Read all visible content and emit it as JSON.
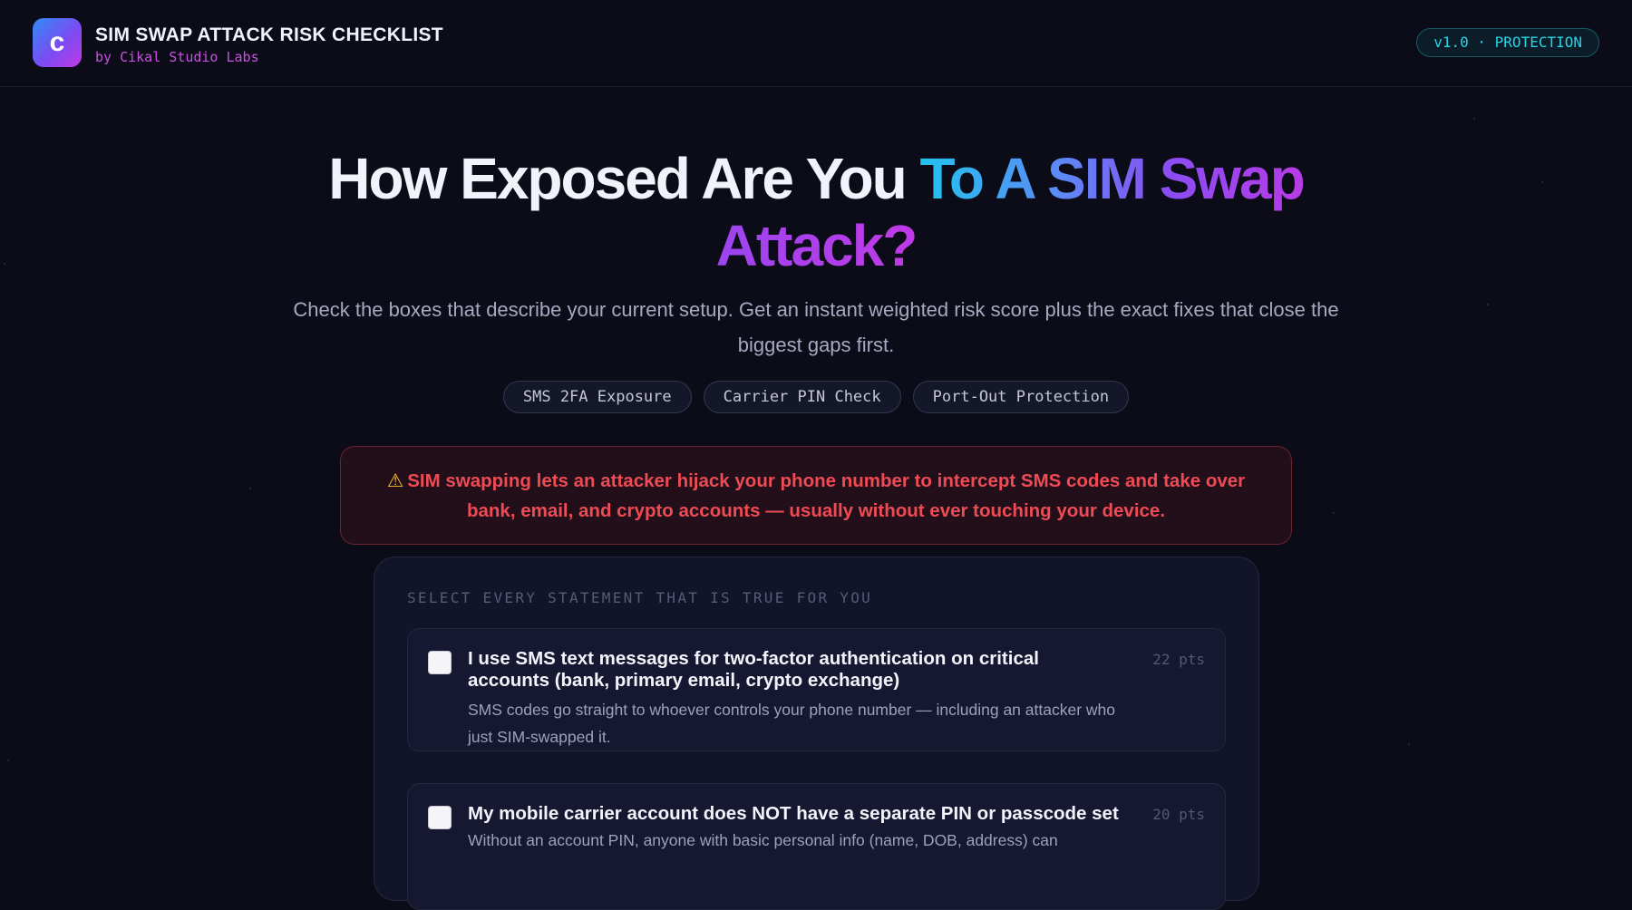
{
  "header": {
    "logo_letter": "c",
    "title": "SIM SWAP ATTACK RISK CHECKLIST",
    "subtitle": "by Cikal Studio Labs",
    "version_badge": "v1.0 · PROTECTION"
  },
  "hero": {
    "title_white": "How Exposed Are You",
    "title_gradient": "To A SIM Swap",
    "title_line2": "Attack?",
    "subtitle": "Check the boxes that describe your current setup. Get an instant weighted risk score plus the exact fixes that close the biggest gaps first.",
    "pills": [
      "SMS 2FA Exposure",
      "Carrier PIN Check",
      "Port-Out Protection"
    ]
  },
  "alert": {
    "icon": "warning-icon",
    "text": "SIM swapping lets an attacker hijack your phone number to intercept SMS codes and take over bank, email, and crypto accounts — usually without ever touching your device."
  },
  "checklist": {
    "heading": "SELECT EVERY STATEMENT THAT IS TRUE FOR YOU",
    "items": [
      {
        "title": "I use SMS text messages for two-factor authentication on critical accounts (bank, primary email, crypto exchange)",
        "description": "SMS codes go straight to whoever controls your phone number — including an attacker who just SIM-swapped it.",
        "points": "22 pts",
        "checked": false
      },
      {
        "title": "My mobile carrier account does NOT have a separate PIN or passcode set",
        "description": "Without an account PIN, anyone with basic personal info (name, DOB, address) can",
        "points": "20 pts",
        "checked": false
      }
    ]
  },
  "colors": {
    "background": "#0b0c18",
    "accent_cyan": "#22c3ee",
    "accent_purple": "#b83be6",
    "alert_red": "#ef4b55"
  }
}
